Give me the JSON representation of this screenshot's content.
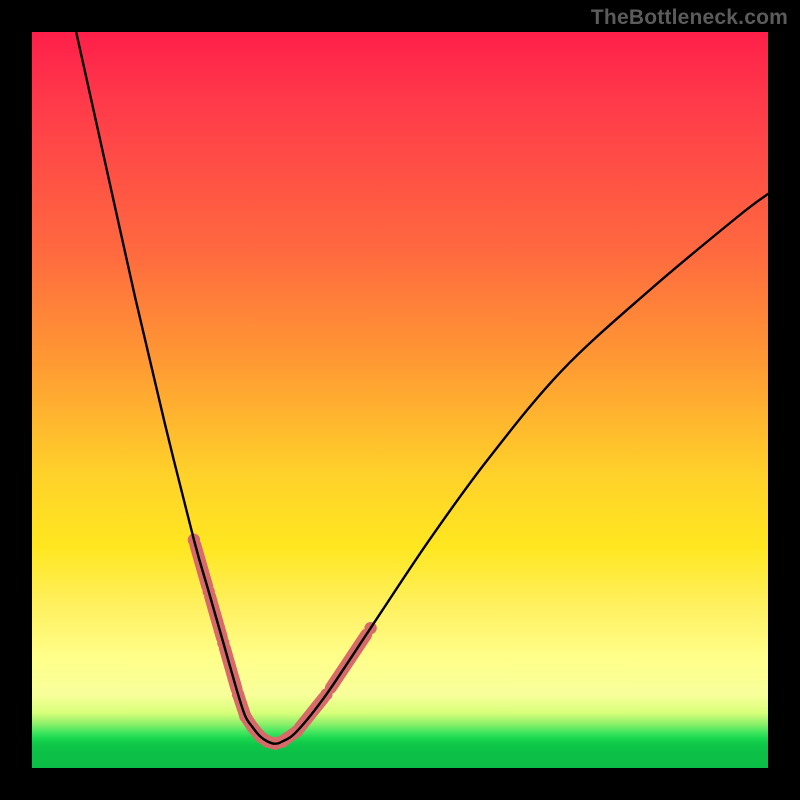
{
  "watermark_text": "TheBottleneck.com",
  "colors": {
    "bg": "#000000",
    "curve": "#000000",
    "marker": "#d86a6a",
    "watermark": "#5b5b5b"
  },
  "chart_data": {
    "type": "line",
    "title": "",
    "xlabel": "",
    "ylabel": "",
    "xlim": [
      0,
      100
    ],
    "ylim": [
      0,
      100
    ],
    "grid": false,
    "legend": false,
    "series": [
      {
        "name": "bottleneck-curve",
        "x": [
          6,
          10,
          14,
          18,
          22,
          24,
          26,
          28,
          29,
          30,
          31,
          32,
          33,
          34,
          36,
          40,
          46,
          54,
          62,
          72,
          84,
          96,
          100
        ],
        "values": [
          100,
          82,
          64,
          47,
          31,
          24,
          17,
          10,
          7,
          5.5,
          4.3,
          3.6,
          3.3,
          3.6,
          5,
          10,
          19,
          31,
          42,
          54,
          65,
          75,
          78
        ]
      }
    ],
    "marker_region": {
      "series": "bottleneck-curve",
      "x_start": 22,
      "x_end": 46,
      "note": "highlighted segment of the curve rendered with thick salmon dots/segments"
    },
    "background_gradient_stops": [
      {
        "pos": 0,
        "color": "#ff1f4a"
      },
      {
        "pos": 0.45,
        "color": "#ff9a33"
      },
      {
        "pos": 0.7,
        "color": "#ffe720"
      },
      {
        "pos": 0.92,
        "color": "#d8ff7a"
      },
      {
        "pos": 0.96,
        "color": "#18d84e"
      },
      {
        "pos": 1.0,
        "color": "#0bbd46"
      }
    ]
  }
}
